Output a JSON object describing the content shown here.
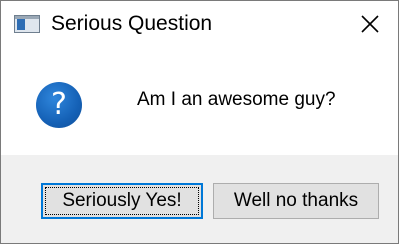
{
  "window": {
    "title": "Serious Question",
    "close_icon": "close-icon",
    "app_icon": "window-icon"
  },
  "dialog": {
    "icon": "question-icon",
    "icon_glyph": "?",
    "message": "Am I an awesome guy?"
  },
  "buttons": {
    "yes_label": "Seriously Yes!",
    "no_label": "Well no thanks"
  },
  "colors": {
    "accent": "#0078d7",
    "question_icon": "#1561b6",
    "footer_bg": "#f0f0f0",
    "button_bg": "#e1e1e1"
  }
}
